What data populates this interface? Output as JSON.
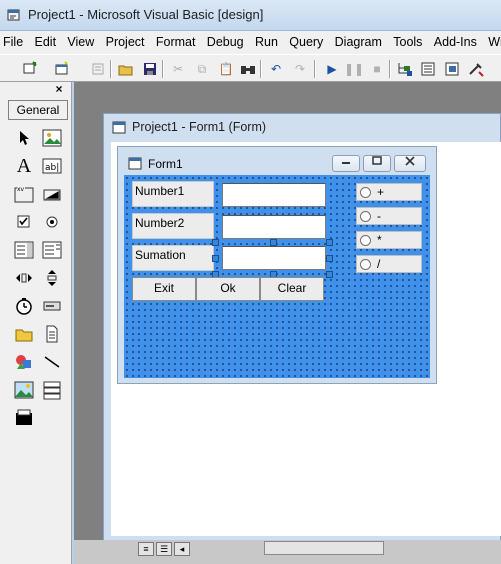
{
  "window": {
    "title": "Project1 - Microsoft Visual Basic [design]"
  },
  "menu": [
    "File",
    "Edit",
    "View",
    "Project",
    "Format",
    "Debug",
    "Run",
    "Query",
    "Diagram",
    "Tools",
    "Add-Ins",
    "Windo"
  ],
  "toolbox": {
    "close_glyph": "×",
    "tab_label": "General",
    "tools": [
      "pointer-icon",
      "picturebox-icon",
      "label-icon",
      "textbox-icon",
      "frame-icon",
      "commandbutton-icon",
      "checkbox-icon",
      "optionbutton-icon",
      "combobox-icon",
      "listbox-icon",
      "hscrollbar-icon",
      "vscrollbar-icon",
      "timer-icon",
      "drivelistbox-icon",
      "dirlistbox-icon",
      "filelistbox-icon",
      "shape-icon",
      "line-icon",
      "image-icon",
      "data-icon",
      "ole-icon"
    ]
  },
  "designer": {
    "title": "Project1 - Form1 (Form)"
  },
  "form": {
    "title": "Form1",
    "back_color": "#3f91ea",
    "labels": {
      "number1": "Number1",
      "number2": "Number2",
      "sumation": "Sumation"
    },
    "buttons": {
      "exit": "Exit",
      "ok": "Ok",
      "clear": "Clear"
    },
    "options": {
      "plus": "+",
      "minus": "-",
      "multiply": "*",
      "divide": "/"
    }
  }
}
